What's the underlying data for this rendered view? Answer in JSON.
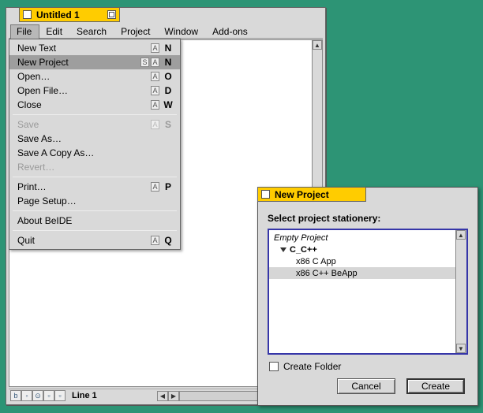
{
  "editor": {
    "title": "Untitled 1",
    "menus": [
      "File",
      "Edit",
      "Search",
      "Project",
      "Window",
      "Add-ons"
    ],
    "file_menu": {
      "items": [
        {
          "label": "New Text",
          "mods": [
            "A"
          ],
          "key": "N"
        },
        {
          "label": "New Project",
          "mods": [
            "S",
            "A"
          ],
          "key": "N",
          "highlight": true
        },
        {
          "label": "Open…",
          "mods": [
            "A"
          ],
          "key": "O"
        },
        {
          "label": "Open File…",
          "mods": [
            "A"
          ],
          "key": "D"
        },
        {
          "label": "Close",
          "mods": [
            "A"
          ],
          "key": "W"
        },
        {
          "sep": true
        },
        {
          "label": "Save",
          "mods": [
            "A"
          ],
          "key": "S",
          "disabled": true
        },
        {
          "label": "Save As…"
        },
        {
          "label": "Save A Copy As…"
        },
        {
          "label": "Revert…",
          "disabled": true
        },
        {
          "sep": true
        },
        {
          "label": "Print…",
          "mods": [
            "A"
          ],
          "key": "P"
        },
        {
          "label": "Page Setup…"
        },
        {
          "sep": true
        },
        {
          "label": "About BeIDE"
        },
        {
          "sep": true
        },
        {
          "label": "Quit",
          "mods": [
            "A"
          ],
          "key": "Q"
        }
      ]
    },
    "status": "Line 1"
  },
  "dialog": {
    "title": "New Project",
    "prompt": "Select project stationery:",
    "tree": [
      {
        "label": "Empty Project",
        "italic": true
      },
      {
        "label": "C_C++",
        "bold": true,
        "expanded": true
      },
      {
        "label": "x86 C App",
        "indent": 2
      },
      {
        "label": "x86 C++ BeApp",
        "indent": 2,
        "selected": true
      }
    ],
    "checkbox_label": "Create Folder",
    "cancel": "Cancel",
    "create": "Create"
  }
}
